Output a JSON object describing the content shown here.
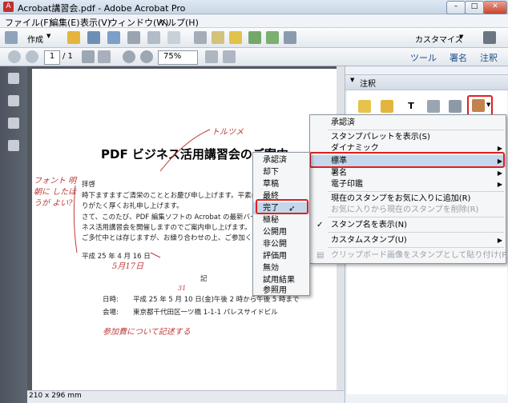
{
  "window": {
    "title": "Acrobat講習会.pdf - Adobe Acrobat Pro",
    "min": "–",
    "max": "□",
    "close": "✕"
  },
  "menubar": [
    "ファイル(F)",
    "編集(E)",
    "表示(V)",
    "ウィンドウ(W)",
    "ヘルプ(H)"
  ],
  "toolbar1": {
    "create": "作成",
    "customize": "カスタマイズ"
  },
  "toolbar2": {
    "page": "1",
    "pages": "/ 1",
    "zoom": "75%",
    "tools": "ツール",
    "sign": "署名",
    "comment": "注釈"
  },
  "panel": {
    "section": "注釈"
  },
  "document": {
    "title": "PDF ビジネス活用講習会のご案内",
    "lines": [
      "拝啓",
      "時下ますますご清栄のこととお慶び申し上げます。平素は格別の",
      "りがたく厚くお礼申し上げます。",
      "さて、このたび、PDF 編集ソフトの Acrobat の最新バージョン Ac",
      "ネス活用講習会を開催しますのでご案内申し上げます。",
      "ご多忙中とは存じますが、お繰り合わせの上、ご参加くださいま"
    ],
    "date_line": "平成 25 年 4 月 16 日",
    "ki": "記",
    "datetime_label": "日時:",
    "datetime_value": "平成 25 年 5 月 10 日(金)午後 2 時から午後 5 時まで",
    "venue_label": "会場:",
    "venue_value": "東京都千代田区一ツ橋 1-1-1 パレスサイドビル",
    "size": "210 x 296 mm"
  },
  "handwriting": {
    "top": "トルツメ",
    "left": "フォント 明朝に したほうが よい?",
    "date": "5月17日",
    "num": "31",
    "bottom": "参加費について記述する"
  },
  "stamp_submenu": [
    "承認済",
    "却下",
    "草稿",
    "最終",
    "完了",
    "極秘",
    "公開用",
    "非公開",
    "評価用",
    "無効",
    "試用結果",
    "参照用"
  ],
  "stamp_menu": {
    "items": [
      {
        "label": "承認済"
      },
      {
        "label": "スタンプパレットを表示(S)"
      },
      {
        "label": "ダイナミック"
      },
      {
        "label": "標準"
      },
      {
        "label": "署名"
      },
      {
        "label": "電子印鑑"
      },
      {
        "label": "現在のスタンプをお気に入りに追加(R)"
      },
      {
        "label": "お気に入りから現在のスタンプを削除(R)"
      },
      {
        "label": "スタンプ名を表示(N)"
      },
      {
        "label": "カスタムスタンプ(U)"
      },
      {
        "label": "クリップボード画像をスタンプとして貼り付け(P)"
      }
    ]
  },
  "colors": {
    "highlight_red": "#e02020",
    "selected": "#c5d7ea"
  }
}
